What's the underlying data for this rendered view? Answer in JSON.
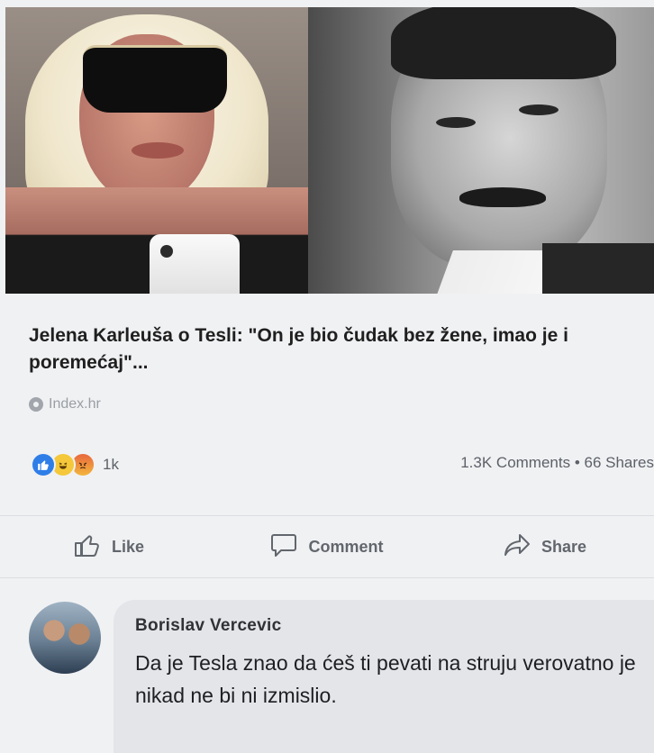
{
  "link_preview": {
    "headline": "Jelena Karleuša o Tesli: \"On je bio čudak bez žene, imao je i poremećaj\"...",
    "source": "Index.hr"
  },
  "stats": {
    "reaction_count": "1k",
    "comments_shares": "1.3K Comments • 66 Shares"
  },
  "actions": {
    "like_label": "Like",
    "comment_label": "Comment",
    "share_label": "Share"
  },
  "comment": {
    "author": "Borislav Vercevic",
    "text": "Da je Tesla znao da ćeš ti pevati na struju verovatno je nikad ne bi ni izmislio."
  },
  "colors": {
    "like_blue": "#2f7ee8",
    "text_secondary": "#62666d"
  }
}
